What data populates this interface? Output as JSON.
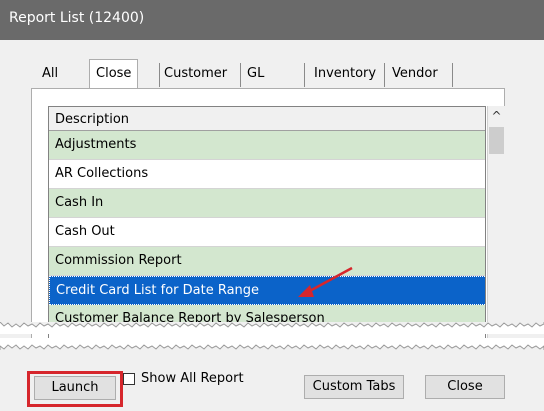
{
  "window": {
    "title": "Report List (12400)"
  },
  "tabs": [
    "All",
    "Close",
    "Customer",
    "GL",
    "Inventory",
    "Vendor"
  ],
  "grid": {
    "header": "Description",
    "rows": [
      {
        "label": "Adjustments",
        "style": "green"
      },
      {
        "label": "AR Collections",
        "style": "white"
      },
      {
        "label": "Cash In",
        "style": "green"
      },
      {
        "label": "Cash Out",
        "style": "white"
      },
      {
        "label": "Commission Report",
        "style": "green"
      },
      {
        "label": "Credit Card List for Date Range",
        "style": "selected"
      },
      {
        "label": "Customer Balance Report by Salesperson",
        "style": "green"
      }
    ]
  },
  "buttons": {
    "launch": "Launch",
    "show_all_report": "Show All Report",
    "custom_tabs": "Custom Tabs",
    "close": "Close"
  },
  "colors": {
    "row_green": "#d3e7cf",
    "selected": "#0b63c9",
    "highlight": "#d6262c"
  }
}
